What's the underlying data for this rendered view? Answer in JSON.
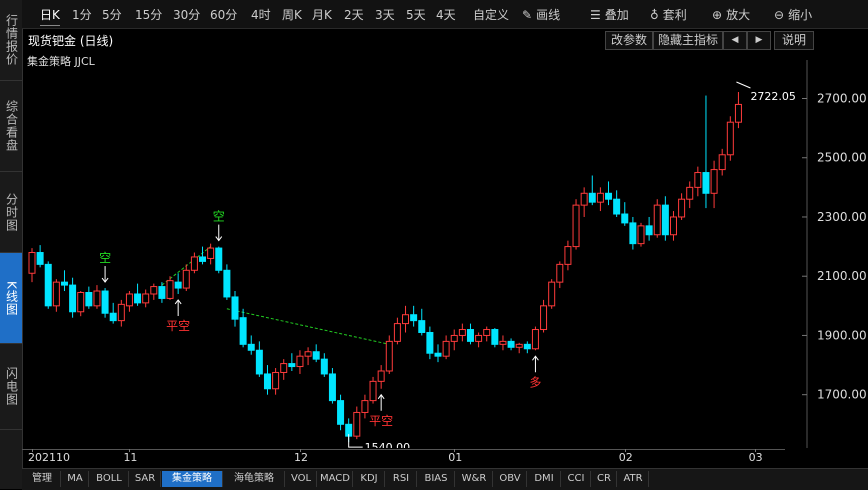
{
  "sidebar": {
    "items": [
      {
        "label": "行情报价",
        "active": false
      },
      {
        "label": "综合看盘",
        "active": false
      },
      {
        "label": "分时图",
        "active": false
      },
      {
        "label": "K线图",
        "active": true
      },
      {
        "label": "闪电图",
        "active": false
      }
    ]
  },
  "toolbar": {
    "periods": [
      "日K",
      "1分",
      "5分",
      "15分",
      "30分",
      "60分",
      "4时",
      "周K",
      "月K",
      "2天",
      "3天",
      "5天",
      "4天",
      "自定义"
    ],
    "active_period": "日K",
    "tools": [
      {
        "label": "画线",
        "icon": "pencil-icon"
      },
      {
        "label": "叠加",
        "icon": "stack-icon"
      },
      {
        "label": "套利",
        "icon": "money-bag-icon"
      },
      {
        "label": "放大",
        "icon": "zoom-in-icon"
      },
      {
        "label": "缩小",
        "icon": "zoom-out-icon"
      }
    ]
  },
  "title_bar": {
    "title": "现货钯金 (日线)",
    "buttons": {
      "edit_params": "改参数",
      "hide_indicator": "隐藏主指标",
      "prev": "◀",
      "next": "▶",
      "help": "说明"
    }
  },
  "strategy_label": "集金策略 JJCL",
  "colors": {
    "up": "#ff3b3b",
    "down": "#00e5ff",
    "signal_green": "#22dd22",
    "signal_red": "#ff3333",
    "dashed": "#22cc22"
  },
  "chart_data": {
    "type": "candlestick",
    "title": "现货钯金 (日线)",
    "y_ticks": [
      "2700.00",
      "2500.00",
      "2300.00",
      "2100.00",
      "1900.00",
      "1700.00"
    ],
    "y_tick_values": [
      2700,
      2500,
      2300,
      2100,
      1900,
      1700
    ],
    "ylim": [
      1520,
      2830
    ],
    "x_labels": [
      "202110",
      "11",
      "12",
      "01",
      "02",
      "03"
    ],
    "x_label_index": [
      0,
      12,
      33,
      52,
      73,
      89
    ],
    "grid": false,
    "annotations": {
      "high_label": "2722.05",
      "low_label": "1540.00",
      "signals": [
        {
          "text": "空",
          "color": "green",
          "index": 9,
          "arrow": "down"
        },
        {
          "text": "平空",
          "color": "red",
          "index": 18,
          "arrow": "up"
        },
        {
          "text": "空",
          "color": "green",
          "index": 23,
          "arrow": "down"
        },
        {
          "text": "平空",
          "color": "red",
          "index": 43,
          "arrow": "up"
        },
        {
          "text": "多",
          "color": "red",
          "index": 62,
          "arrow": "up"
        }
      ]
    },
    "candles": [
      [
        2110,
        2195,
        2080,
        2180
      ],
      [
        2180,
        2205,
        2130,
        2140
      ],
      [
        2140,
        2150,
        1990,
        2000
      ],
      [
        2000,
        2090,
        1980,
        2080
      ],
      [
        2080,
        2120,
        2050,
        2070
      ],
      [
        2070,
        2095,
        1960,
        1980
      ],
      [
        1980,
        2050,
        1965,
        2045
      ],
      [
        2045,
        2065,
        1990,
        2000
      ],
      [
        2000,
        2070,
        1990,
        2050
      ],
      [
        2050,
        2060,
        1960,
        1975
      ],
      [
        1975,
        2010,
        1940,
        1950
      ],
      [
        1950,
        2020,
        1930,
        2005
      ],
      [
        2000,
        2050,
        1980,
        2040
      ],
      [
        2040,
        2075,
        2000,
        2010
      ],
      [
        2010,
        2055,
        1995,
        2040
      ],
      [
        2040,
        2075,
        2020,
        2065
      ],
      [
        2065,
        2080,
        2010,
        2025
      ],
      [
        2025,
        2100,
        2020,
        2085
      ],
      [
        2080,
        2110,
        2040,
        2060
      ],
      [
        2060,
        2140,
        2050,
        2120
      ],
      [
        2120,
        2180,
        2110,
        2165
      ],
      [
        2165,
        2200,
        2140,
        2150
      ],
      [
        2160,
        2210,
        2140,
        2195
      ],
      [
        2195,
        2200,
        2110,
        2120
      ],
      [
        2120,
        2140,
        2020,
        2030
      ],
      [
        2030,
        2050,
        1930,
        1955
      ],
      [
        1960,
        1990,
        1860,
        1870
      ],
      [
        1870,
        1900,
        1835,
        1850
      ],
      [
        1850,
        1880,
        1760,
        1770
      ],
      [
        1770,
        1800,
        1700,
        1720
      ],
      [
        1720,
        1790,
        1700,
        1775
      ],
      [
        1775,
        1820,
        1750,
        1805
      ],
      [
        1805,
        1840,
        1780,
        1795
      ],
      [
        1795,
        1850,
        1770,
        1830
      ],
      [
        1830,
        1860,
        1800,
        1845
      ],
      [
        1845,
        1870,
        1810,
        1820
      ],
      [
        1820,
        1840,
        1760,
        1770
      ],
      [
        1770,
        1790,
        1670,
        1680
      ],
      [
        1680,
        1700,
        1580,
        1600
      ],
      [
        1600,
        1620,
        1540,
        1560
      ],
      [
        1560,
        1660,
        1550,
        1640
      ],
      [
        1640,
        1700,
        1620,
        1680
      ],
      [
        1680,
        1760,
        1670,
        1745
      ],
      [
        1745,
        1800,
        1720,
        1780
      ],
      [
        1780,
        1900,
        1770,
        1880
      ],
      [
        1880,
        1960,
        1870,
        1940
      ],
      [
        1940,
        2000,
        1910,
        1970
      ],
      [
        1970,
        2000,
        1930,
        1950
      ],
      [
        1950,
        1990,
        1900,
        1910
      ],
      [
        1910,
        1930,
        1820,
        1840
      ],
      [
        1840,
        1870,
        1810,
        1830
      ],
      [
        1830,
        1900,
        1820,
        1880
      ],
      [
        1880,
        1920,
        1850,
        1900
      ],
      [
        1900,
        1940,
        1880,
        1920
      ],
      [
        1920,
        1940,
        1870,
        1880
      ],
      [
        1880,
        1910,
        1860,
        1900
      ],
      [
        1900,
        1930,
        1880,
        1920
      ],
      [
        1920,
        1925,
        1860,
        1870
      ],
      [
        1870,
        1900,
        1850,
        1880
      ],
      [
        1880,
        1890,
        1850,
        1860
      ],
      [
        1860,
        1875,
        1840,
        1870
      ],
      [
        1870,
        1880,
        1840,
        1855
      ],
      [
        1855,
        1930,
        1850,
        1920
      ],
      [
        1920,
        2020,
        1910,
        2000
      ],
      [
        2000,
        2090,
        1990,
        2080
      ],
      [
        2080,
        2150,
        2060,
        2140
      ],
      [
        2140,
        2220,
        2120,
        2200
      ],
      [
        2200,
        2360,
        2190,
        2340
      ],
      [
        2340,
        2400,
        2300,
        2380
      ],
      [
        2380,
        2440,
        2340,
        2350
      ],
      [
        2350,
        2400,
        2320,
        2380
      ],
      [
        2380,
        2420,
        2340,
        2360
      ],
      [
        2360,
        2390,
        2300,
        2310
      ],
      [
        2310,
        2350,
        2270,
        2280
      ],
      [
        2280,
        2300,
        2190,
        2210
      ],
      [
        2210,
        2280,
        2200,
        2270
      ],
      [
        2270,
        2300,
        2220,
        2240
      ],
      [
        2240,
        2360,
        2230,
        2340
      ],
      [
        2340,
        2370,
        2220,
        2240
      ],
      [
        2240,
        2320,
        2220,
        2300
      ],
      [
        2300,
        2380,
        2290,
        2360
      ],
      [
        2360,
        2420,
        2330,
        2400
      ],
      [
        2400,
        2470,
        2370,
        2450
      ],
      [
        2450,
        2710,
        2330,
        2380
      ],
      [
        2380,
        2490,
        2330,
        2460
      ],
      [
        2460,
        2530,
        2440,
        2510
      ],
      [
        2510,
        2640,
        2490,
        2620
      ],
      [
        2620,
        2722,
        2600,
        2680
      ]
    ],
    "dashed_lines": [
      [
        16,
        2070,
        22,
        2200
      ],
      [
        24,
        1990,
        44,
        1870
      ]
    ]
  },
  "bottom_tabs": {
    "items": [
      "管理",
      "MA",
      "BOLL",
      "SAR",
      "集金策略",
      "海龟策略",
      "VOL",
      "MACD",
      "KDJ",
      "RSI",
      "BIAS",
      "W&R",
      "OBV",
      "DMI",
      "CCI",
      "CR",
      "ATR"
    ],
    "active": "集金策略"
  }
}
